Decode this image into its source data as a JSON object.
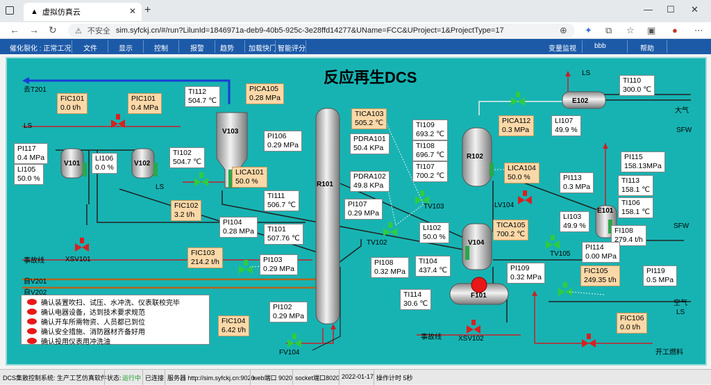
{
  "browser": {
    "tab_title": "虚拟仿真云",
    "insecure_label": "不安全",
    "url": "sim.syfckj.cn/#/run?LilunId=1846971a-deb9-40b5-925c-3e28ffd14277&UName=FCC&UProject=1&ProjectType=17"
  },
  "menu": {
    "mode": "催化裂化 : 正常工况",
    "file": "文件",
    "view": "显示",
    "control": "控制",
    "alarm": "报警",
    "trend": "趋势",
    "speed": "加载快门",
    "score": "智能评分",
    "monitor": "变量监视",
    "user": "bbb",
    "help": "帮助"
  },
  "title": "反应再生DCS",
  "labels": {
    "to_t201": "去T201",
    "ls1": "LS",
    "ls2": "LS",
    "ls_top": "LS",
    "ls_right": "LS",
    "sfw1": "SFW",
    "sfw2": "SFW",
    "atm": "大气",
    "air": "空气",
    "accident1": "事故线",
    "accident2": "事故线",
    "from_v201": "自V201",
    "from_v202": "自V202",
    "fuel": "开工燃料"
  },
  "vessels": {
    "v101": "V101",
    "v102": "V102",
    "v103": "V103",
    "r101": "R101",
    "r102": "R102",
    "v104": "V104",
    "e101": "E101",
    "e102": "E102",
    "f101": "F101"
  },
  "valves": {
    "tv103": "TV103",
    "tv102": "TV102",
    "tv105": "TV105",
    "lv104": "LV104",
    "xsv101": "XSV101",
    "xsv102": "XSV102",
    "fv104": "FV104"
  },
  "tags": [
    {
      "id": "fic101",
      "tag": "FIC101",
      "val": "0.0      t/h",
      "orange": true
    },
    {
      "id": "pic101",
      "tag": "PIC101",
      "val": "0.4   MPa",
      "orange": true
    },
    {
      "id": "ti112",
      "tag": "TI112",
      "val": "504.7  ℃",
      "orange": false
    },
    {
      "id": "pica105",
      "tag": "PICA105",
      "val": "0.28   MPa",
      "orange": true
    },
    {
      "id": "pi117",
      "tag": "PI117",
      "val": "0.4    MPa",
      "orange": false
    },
    {
      "id": "li105",
      "tag": "LI105",
      "val": "50.0    %",
      "orange": false
    },
    {
      "id": "li106",
      "tag": "LI106",
      "val": "0.0    %",
      "orange": false
    },
    {
      "id": "ti102",
      "tag": "TI102",
      "val": "504.7  ℃",
      "orange": false
    },
    {
      "id": "pi106",
      "tag": "PI106",
      "val": "0.29   MPa",
      "orange": false
    },
    {
      "id": "lica101",
      "tag": "LICA101",
      "val": "50.0     %",
      "orange": true
    },
    {
      "id": "fic102",
      "tag": "FIC102",
      "val": "3.2     t/h",
      "orange": true
    },
    {
      "id": "ti111",
      "tag": "TI111",
      "val": "506.7  ℃",
      "orange": false
    },
    {
      "id": "pi104",
      "tag": "PI104",
      "val": "0.28  MPa",
      "orange": false
    },
    {
      "id": "ti101",
      "tag": "TI101",
      "val": "507.76 ℃",
      "orange": false
    },
    {
      "id": "tica103",
      "tag": "TICA103",
      "val": "505.2   ℃",
      "orange": true
    },
    {
      "id": "pdra101",
      "tag": "PDRA101",
      "val": "50.4   KPa",
      "orange": false
    },
    {
      "id": "pdra102",
      "tag": "PDRA102",
      "val": "49.8   KPa",
      "orange": false
    },
    {
      "id": "pi107",
      "tag": "PI107",
      "val": "0.29   MPa",
      "orange": false
    },
    {
      "id": "fic103",
      "tag": "FIC103",
      "val": "214.2    t/h",
      "orange": true
    },
    {
      "id": "pi103",
      "tag": "PI103",
      "val": "0.29   MPa",
      "orange": false
    },
    {
      "id": "pi102",
      "tag": "PI102",
      "val": "0.29   MPa",
      "orange": false
    },
    {
      "id": "fic104",
      "tag": "FIC104",
      "val": "6.42      t/h",
      "orange": true
    },
    {
      "id": "ti109",
      "tag": "TI109",
      "val": "693.2   ℃",
      "orange": false
    },
    {
      "id": "ti108",
      "tag": "TI108",
      "val": "696.7   ℃",
      "orange": false
    },
    {
      "id": "ti107",
      "tag": "TI107",
      "val": "700.2   ℃",
      "orange": false
    },
    {
      "id": "pica112",
      "tag": "PICA112",
      "val": "0.3     MPa",
      "orange": true
    },
    {
      "id": "lica104",
      "tag": "LICA104",
      "val": "50.0     %",
      "orange": true
    },
    {
      "id": "li102",
      "tag": "LI102",
      "val": "50.0     %",
      "orange": false
    },
    {
      "id": "tica105",
      "tag": "TICA105",
      "val": "700.2  ℃",
      "orange": true
    },
    {
      "id": "pi108",
      "tag": "PI108",
      "val": "0.32   MPa",
      "orange": false
    },
    {
      "id": "ti104",
      "tag": "TI104",
      "val": "437.4   ℃",
      "orange": false
    },
    {
      "id": "pi109",
      "tag": "PI109",
      "val": "0.32   MPa",
      "orange": false
    },
    {
      "id": "ti114",
      "tag": "TI114",
      "val": "30.6    ℃",
      "orange": false
    },
    {
      "id": "ti110",
      "tag": "TI110",
      "val": "300.0   ℃",
      "orange": false
    },
    {
      "id": "li107",
      "tag": "LI107",
      "val": "49.9     %",
      "orange": false
    },
    {
      "id": "pi115",
      "tag": "PI115",
      "val": "158.13MPa",
      "orange": false
    },
    {
      "id": "pi113",
      "tag": "PI113",
      "val": "0.3     MPa",
      "orange": false
    },
    {
      "id": "ti113",
      "tag": "TI113",
      "val": "158.1    ℃",
      "orange": false
    },
    {
      "id": "ti106",
      "tag": "TI106",
      "val": "158.1    ℃",
      "orange": false
    },
    {
      "id": "li103",
      "tag": "LI103",
      "val": "49.9     %",
      "orange": false
    },
    {
      "id": "fi108",
      "tag": "FI108",
      "val": "279.4    t/h",
      "orange": false
    },
    {
      "id": "pi114",
      "tag": "PI114",
      "val": "0.00   MPa",
      "orange": false
    },
    {
      "id": "fic105",
      "tag": "FIC105",
      "val": "249.35  t/h",
      "orange": true
    },
    {
      "id": "pi119",
      "tag": "PI119",
      "val": "0.5    MPa",
      "orange": false
    },
    {
      "id": "fic106",
      "tag": "FIC106",
      "val": "0.0       t/h",
      "orange": true
    }
  ],
  "checklist": [
    "确认装置吹扫、试压、水冲洗、仪表联校完毕",
    "确认电器设备，达到技术要求规范",
    "确认开车所需物资、人员都已到位",
    "确认安全措施、消防器材齐备好用",
    "确认投用仪表用冲洗油"
  ],
  "status": {
    "system": "DCS集散控制系统: 生产工艺仿真软件",
    "state_label": "状态:",
    "state_value": "运行中",
    "conn": "已连接",
    "server": "服务器 http://sim.syfckj.cn:9020",
    "web": "web端口 9020",
    "socket": "socket端口8020",
    "date": "2022-01-17",
    "timer": "操作计时 5秒"
  },
  "colors": {
    "canvas": "#17b3b2",
    "menubar": "#1c5aa8",
    "alarm": "#e81818",
    "orange_box": "#fbd8a8"
  }
}
